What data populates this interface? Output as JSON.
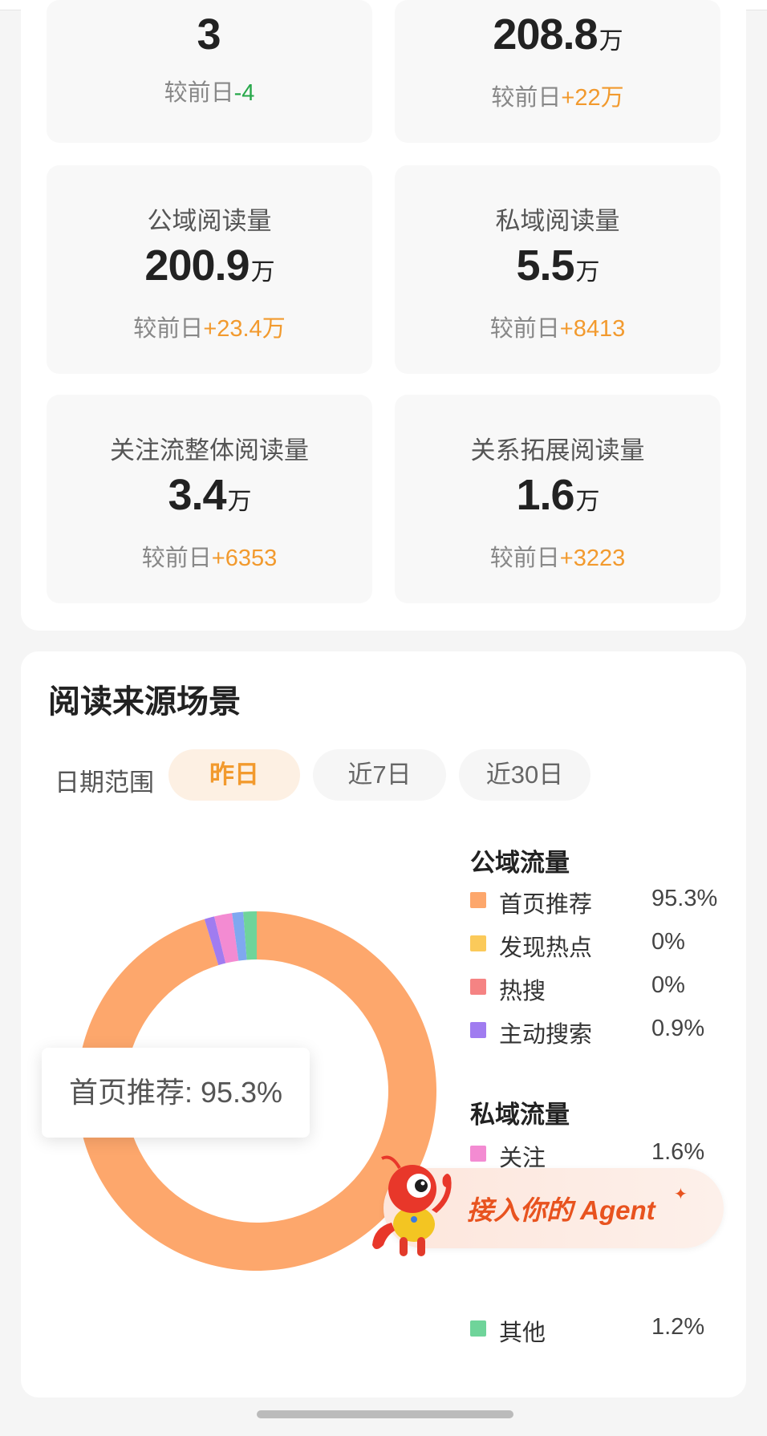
{
  "stats": [
    {
      "label": "",
      "value": "3",
      "unit": "",
      "compare_prefix": "较前日",
      "compare_value": "-4",
      "trend": "down"
    },
    {
      "label": "",
      "value": "208.8",
      "unit": "万",
      "compare_prefix": "较前日",
      "compare_value": "+22万",
      "trend": "up"
    },
    {
      "label": "公域阅读量",
      "value": "200.9",
      "unit": "万",
      "compare_prefix": "较前日",
      "compare_value": "+23.4万",
      "trend": "up"
    },
    {
      "label": "私域阅读量",
      "value": "5.5",
      "unit": "万",
      "compare_prefix": "较前日",
      "compare_value": "+8413",
      "trend": "up"
    },
    {
      "label": "关注流整体阅读量",
      "value": "3.4",
      "unit": "万",
      "compare_prefix": "较前日",
      "compare_value": "+6353",
      "trend": "up"
    },
    {
      "label": "关系拓展阅读量",
      "value": "1.6",
      "unit": "万",
      "compare_prefix": "较前日",
      "compare_value": "+3223",
      "trend": "up"
    }
  ],
  "source_section": {
    "title": "阅读来源场景",
    "date_range_label": "日期范围",
    "tabs": [
      {
        "label": "昨日",
        "active": true
      },
      {
        "label": "近7日",
        "active": false
      },
      {
        "label": "近30日",
        "active": false
      }
    ],
    "tooltip": "首页推荐: 95.3%",
    "public_group_title": "公域流量",
    "private_group_title": "私域流量"
  },
  "chart_data": {
    "type": "pie",
    "donut": true,
    "series": [
      {
        "name": "首页推荐",
        "group": "公域流量",
        "value": 95.3,
        "label": "95.3%",
        "color": "#fda76c"
      },
      {
        "name": "发现热点",
        "group": "公域流量",
        "value": 0,
        "label": "0%",
        "color": "#fbca5a"
      },
      {
        "name": "热搜",
        "group": "公域流量",
        "value": 0,
        "label": "0%",
        "color": "#f58383"
      },
      {
        "name": "主动搜索",
        "group": "公域流量",
        "value": 0.9,
        "label": "0.9%",
        "color": "#a07cf0"
      },
      {
        "name": "关注",
        "group": "私域流量",
        "value": 1.6,
        "label": "1.6%",
        "color": "#f38bd2"
      },
      {
        "name": "其他",
        "group": "私域流量",
        "value": 1.2,
        "label": "1.2%",
        "color": "#6fd49a"
      }
    ],
    "hidden_segment_colors": [
      "#7fa8f0"
    ]
  },
  "agent_banner": {
    "text": "接入你的 Agent",
    "spark": "✦"
  },
  "colors": {
    "accent": "#f29a2e",
    "down": "#27a84a",
    "agent": "#e8531f"
  }
}
